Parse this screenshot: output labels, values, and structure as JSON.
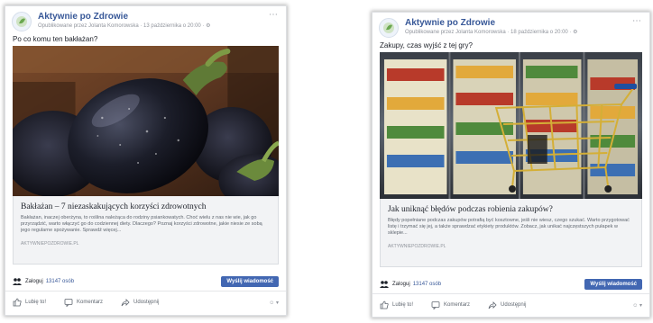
{
  "posts": [
    {
      "page_name": "Aktywnie po Zdrowie",
      "meta": "Opublikowane przez Jolanta Komorowska · 13 października o 20:00 · ⚙",
      "text": "Po co komu ten bakłażan?",
      "link_title": "Bakłażan – 7 niezaskakujących korzyści zdrowotnych",
      "link_desc": "Bakłażan, inaczej oberżyna, to roślina należąca do rodziny psiankowatych. Choć wielu z nas nie wie, jak go przyrządzić, warto włączyć go do codziennej diety. Dlaczego? Poznaj korzyści zdrowotne, jakie niesie ze sobą jego regularne spożywanie. Sprawdź więcej...",
      "link_domain": "aktywniepozdrowie.pl",
      "join_text": "Zaloguj",
      "join_count": "13147 osób",
      "message_button": "Wyślij wiadomość",
      "actions": [
        "Lubię to!",
        "Komentarz",
        "Udostępnij"
      ],
      "more_menu": "⋯",
      "action_menu": "☺ ▾"
    },
    {
      "page_name": "Aktywnie po Zdrowie",
      "meta": "Opublikowane przez Jolanta Komorowska · 18 października o 20:00 · ⚙",
      "text": "Zakupy, czas wyjść z tej gry?",
      "link_title": "Jak uniknąć błędów podczas robienia zakupów?",
      "link_desc": "Błędy popełniane podczas zakupów potrafią być kosztowne, jeśli nie wiesz, czego szukać. Warto przygotować listę i trzymać się jej, a także sprawdzać etykiety produktów. Zobacz, jak unikać najczęstszych pułapek w sklepie...",
      "link_domain": "aktywniepozdrowie.pl",
      "join_text": "Zaloguj",
      "join_count": "13147 osób",
      "message_button": "Wyślij wiadomość",
      "actions": [
        "Lubię to!",
        "Komentarz",
        "Udostępnij"
      ],
      "more_menu": "⋯",
      "action_menu": "☺ ▾"
    }
  ],
  "colors": {
    "facebook_blue": "#4267b2",
    "link_blue": "#385898",
    "gray_text": "#90949c"
  }
}
